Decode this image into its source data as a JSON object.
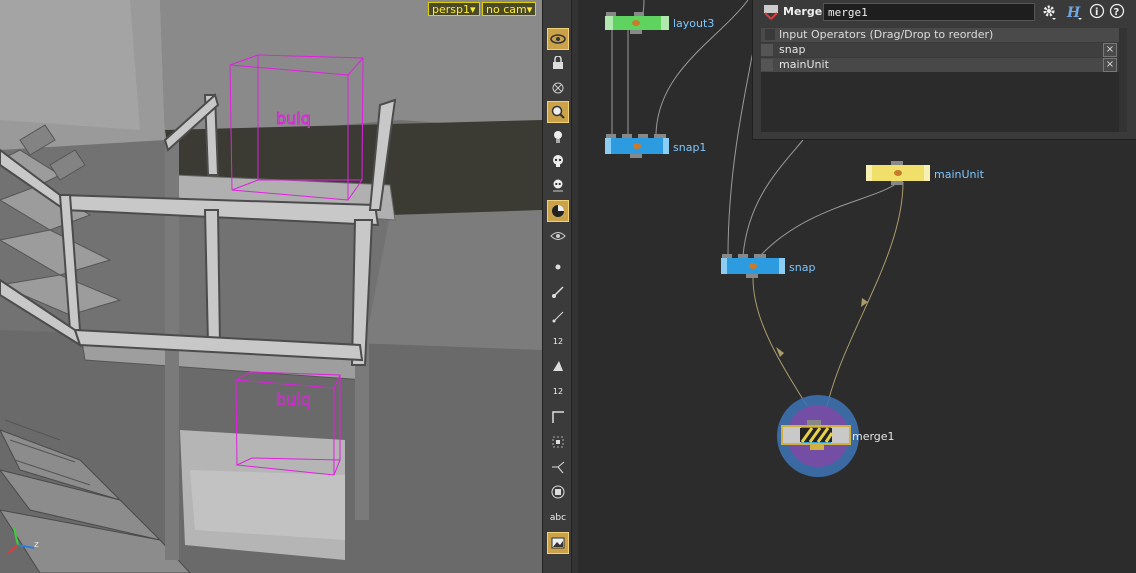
{
  "viewport": {
    "camera_menu": "persp1▾",
    "cam_menu": "no cam▾",
    "axis_label": "z"
  },
  "toolbar": {
    "tools": [
      {
        "name": "display-icon",
        "active": true
      },
      {
        "name": "lock-icon",
        "active": false
      },
      {
        "name": "hide-icon",
        "active": false
      },
      {
        "name": "zoom-icon",
        "active": true
      },
      {
        "name": "light-icon",
        "active": false
      },
      {
        "name": "skull-icon",
        "active": false
      },
      {
        "name": "skull-alt-icon",
        "active": false
      },
      {
        "name": "shading-icon",
        "active": true
      },
      {
        "name": "eye-icon",
        "active": false
      },
      {
        "name": "point-icon",
        "active": false
      },
      {
        "name": "brush-icon",
        "active": false
      },
      {
        "name": "pen-icon",
        "active": false
      },
      {
        "name": "point-number-icon",
        "label": "12",
        "active": false
      },
      {
        "name": "prim-icon",
        "active": false
      },
      {
        "name": "prim-number-icon",
        "label": "12",
        "active": false
      },
      {
        "name": "corner-icon",
        "active": false
      },
      {
        "name": "grid-snap-icon",
        "active": false
      },
      {
        "name": "connect-icon",
        "active": false
      },
      {
        "name": "box-icon",
        "active": false
      },
      {
        "name": "text-icon",
        "label": "abc",
        "active": false
      },
      {
        "name": "image-icon",
        "active": true
      }
    ]
  },
  "param": {
    "type_label": "Merge",
    "node_name": "merge1",
    "list_header": "Input Operators (Drag/Drop to reorder)",
    "inputs": [
      "snap",
      "mainUnit"
    ],
    "remove_label": "×"
  },
  "network": {
    "nodes": {
      "layout3": "layout3",
      "snap1": "snap1",
      "mainUnit": "mainUnit",
      "snap": "snap",
      "merge1": "merge1"
    }
  },
  "colors": {
    "node_green": "#5fd35f",
    "node_blue": "#2d9be0",
    "node_yellow": "#f0e06a",
    "guide_magenta": "#e020e0",
    "accent": "#caa24a"
  }
}
